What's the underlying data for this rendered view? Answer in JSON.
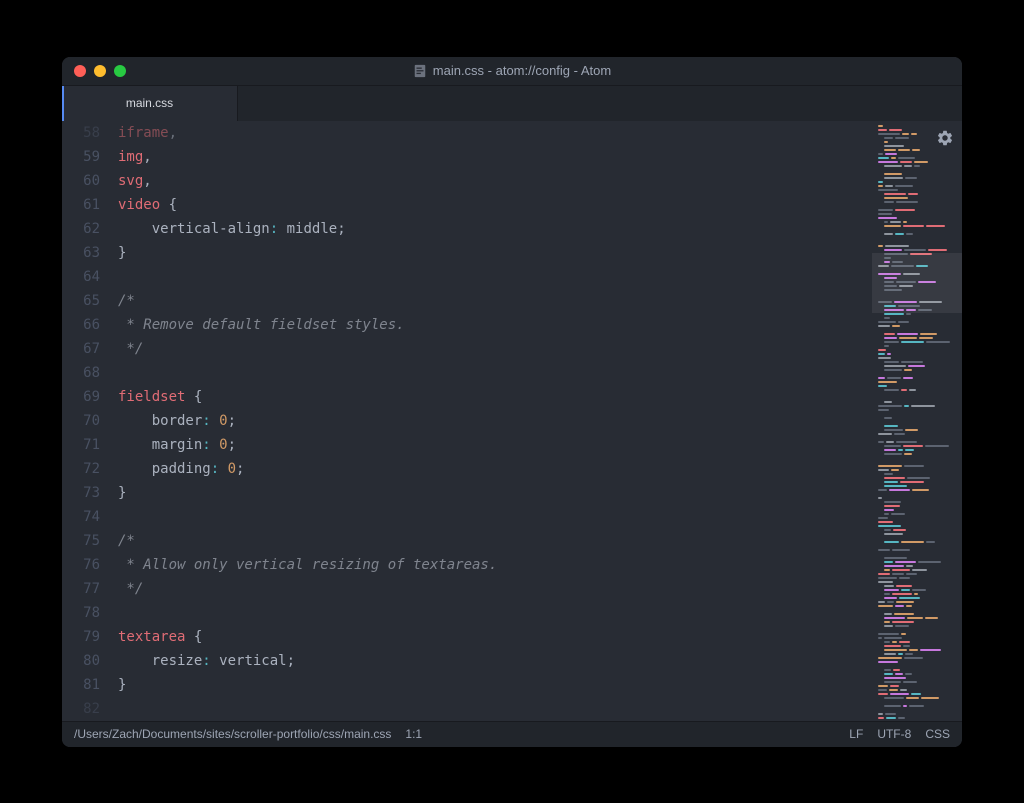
{
  "window": {
    "title": "main.css - atom://config - Atom"
  },
  "tabs": [
    {
      "label": "main.css",
      "active": true
    }
  ],
  "code": {
    "lines": [
      {
        "num": "58",
        "tokens": [
          {
            "text": "iframe",
            "cls": "tag"
          },
          {
            "text": ",",
            "cls": "comma"
          }
        ],
        "faded": true
      },
      {
        "num": "59",
        "tokens": [
          {
            "text": "img",
            "cls": "tag"
          },
          {
            "text": ",",
            "cls": "comma"
          }
        ]
      },
      {
        "num": "60",
        "tokens": [
          {
            "text": "svg",
            "cls": "tag"
          },
          {
            "text": ",",
            "cls": "comma"
          }
        ]
      },
      {
        "num": "61",
        "tokens": [
          {
            "text": "video",
            "cls": "tag"
          },
          {
            "text": " {",
            "cls": "brace"
          }
        ]
      },
      {
        "num": "62",
        "tokens": [
          {
            "text": "    ",
            "cls": ""
          },
          {
            "text": "vertical-align",
            "cls": "prop"
          },
          {
            "text": ":",
            "cls": "colon"
          },
          {
            "text": " middle",
            "cls": "value"
          },
          {
            "text": ";",
            "cls": "punct"
          }
        ]
      },
      {
        "num": "63",
        "tokens": [
          {
            "text": "}",
            "cls": "brace"
          }
        ]
      },
      {
        "num": "64",
        "tokens": []
      },
      {
        "num": "65",
        "tokens": [
          {
            "text": "/*",
            "cls": "comment"
          }
        ]
      },
      {
        "num": "66",
        "tokens": [
          {
            "text": " * Remove default fieldset styles.",
            "cls": "comment"
          }
        ]
      },
      {
        "num": "67",
        "tokens": [
          {
            "text": " */",
            "cls": "comment"
          }
        ]
      },
      {
        "num": "68",
        "tokens": []
      },
      {
        "num": "69",
        "tokens": [
          {
            "text": "fieldset",
            "cls": "tag"
          },
          {
            "text": " {",
            "cls": "brace"
          }
        ]
      },
      {
        "num": "70",
        "tokens": [
          {
            "text": "    ",
            "cls": ""
          },
          {
            "text": "border",
            "cls": "prop"
          },
          {
            "text": ":",
            "cls": "colon"
          },
          {
            "text": " ",
            "cls": ""
          },
          {
            "text": "0",
            "cls": "num"
          },
          {
            "text": ";",
            "cls": "punct"
          }
        ]
      },
      {
        "num": "71",
        "tokens": [
          {
            "text": "    ",
            "cls": ""
          },
          {
            "text": "margin",
            "cls": "prop"
          },
          {
            "text": ":",
            "cls": "colon"
          },
          {
            "text": " ",
            "cls": ""
          },
          {
            "text": "0",
            "cls": "num"
          },
          {
            "text": ";",
            "cls": "punct"
          }
        ]
      },
      {
        "num": "72",
        "tokens": [
          {
            "text": "    ",
            "cls": ""
          },
          {
            "text": "padding",
            "cls": "prop"
          },
          {
            "text": ":",
            "cls": "colon"
          },
          {
            "text": " ",
            "cls": ""
          },
          {
            "text": "0",
            "cls": "num"
          },
          {
            "text": ";",
            "cls": "punct"
          }
        ]
      },
      {
        "num": "73",
        "tokens": [
          {
            "text": "}",
            "cls": "brace"
          }
        ]
      },
      {
        "num": "74",
        "tokens": []
      },
      {
        "num": "75",
        "tokens": [
          {
            "text": "/*",
            "cls": "comment"
          }
        ]
      },
      {
        "num": "76",
        "tokens": [
          {
            "text": " * Allow only vertical resizing of textareas.",
            "cls": "comment"
          }
        ]
      },
      {
        "num": "77",
        "tokens": [
          {
            "text": " */",
            "cls": "comment"
          }
        ]
      },
      {
        "num": "78",
        "tokens": []
      },
      {
        "num": "79",
        "tokens": [
          {
            "text": "textarea",
            "cls": "tag"
          },
          {
            "text": " {",
            "cls": "brace"
          }
        ]
      },
      {
        "num": "80",
        "tokens": [
          {
            "text": "    ",
            "cls": ""
          },
          {
            "text": "resize",
            "cls": "prop"
          },
          {
            "text": ":",
            "cls": "colon"
          },
          {
            "text": " vertical",
            "cls": "value"
          },
          {
            "text": ";",
            "cls": "punct"
          }
        ]
      },
      {
        "num": "81",
        "tokens": [
          {
            "text": "}",
            "cls": "brace"
          }
        ]
      },
      {
        "num": "82",
        "tokens": [],
        "faded": true
      }
    ]
  },
  "statusbar": {
    "path": "/Users/Zach/Documents/sites/scroller-portfolio/css/main.css",
    "cursor": "1:1",
    "line_ending": "LF",
    "encoding": "UTF-8",
    "grammar": "CSS"
  }
}
